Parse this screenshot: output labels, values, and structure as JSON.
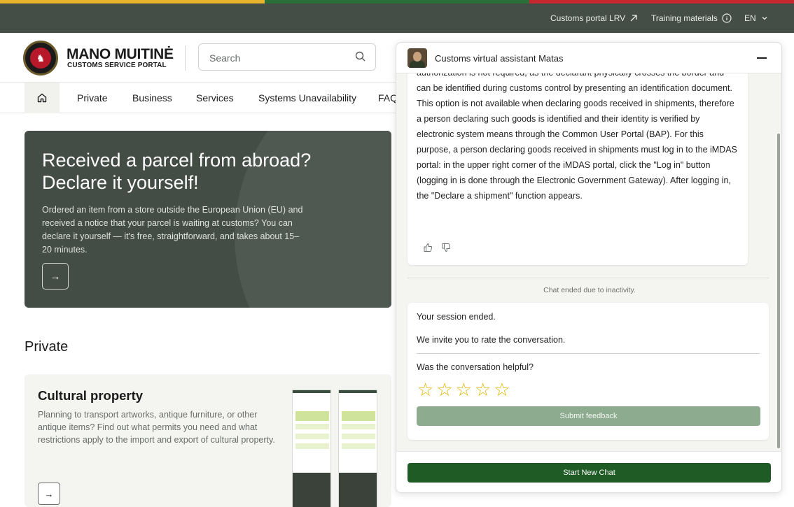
{
  "colors": {
    "flag_yellow": "#e9b32b",
    "flag_green": "#2a6f3a",
    "flag_red": "#c6262e",
    "topbar_bg": "#454d47",
    "hero_bg": "#434d46",
    "primary_green": "#1f5b25",
    "submit_disabled": "#8cab8f",
    "star": "#e3b400"
  },
  "topbar": {
    "portal_link": "Customs portal LRV",
    "portal_icon": "external-arrow-icon",
    "training_link": "Training materials",
    "training_icon": "info-icon",
    "language": "EN",
    "language_icon": "chevron-down-icon"
  },
  "header": {
    "brand_title": "MANO MUITINĖ",
    "brand_subtitle": "CUSTOMS SERVICE PORTAL",
    "search_placeholder": "Search"
  },
  "nav": {
    "items": [
      {
        "label": "Private"
      },
      {
        "label": "Business"
      },
      {
        "label": "Services"
      },
      {
        "label": "Systems Unavailability"
      },
      {
        "label": "FAQ"
      }
    ]
  },
  "hero": {
    "title": "Received a parcel from abroad? Declare it yourself!",
    "text": "Ordered an item from a store outside the European Union (EU) and received a notice that your parcel is waiting at customs? You can declare it yourself — it's free, straightforward, and takes about 15–20 minutes.",
    "arrow": "→"
  },
  "private_section": {
    "title": "Private",
    "card_title": "Cultural property",
    "card_text": "Planning to transport artworks, antique furniture, or other antique items? Find out what permits you need and what restrictions apply to the import and export of cultural property.",
    "card_arrow": "→"
  },
  "chat": {
    "title": "Customs virtual assistant Matas",
    "message": "authorization is not required, as the declarant physically crosses the border and can be identified during customs control by presenting an identification document. This option is not available when declaring goods received in shipments, therefore a person declaring such goods is identified and their identity is verified by electronic system means through the Common User Portal (BAP). For this purpose, a person declaring goods received in shipments must log in to the iMDAS portal: in the upper right corner of the iMDAS portal, click the \"Log in\" button (logging in is done through the Electronic Government Gateway). After logging in, the \"Declare a shipment\" function appears.",
    "ended_notice": "Chat ended due to inactivity.",
    "session_ended": "Your session ended.",
    "invite_rate": "We invite you to rate the conversation.",
    "helpful_question": "Was the conversation helpful?",
    "rating": 0,
    "rating_max": 5,
    "submit_label": "Submit feedback",
    "start_new_label": "Start New Chat"
  }
}
